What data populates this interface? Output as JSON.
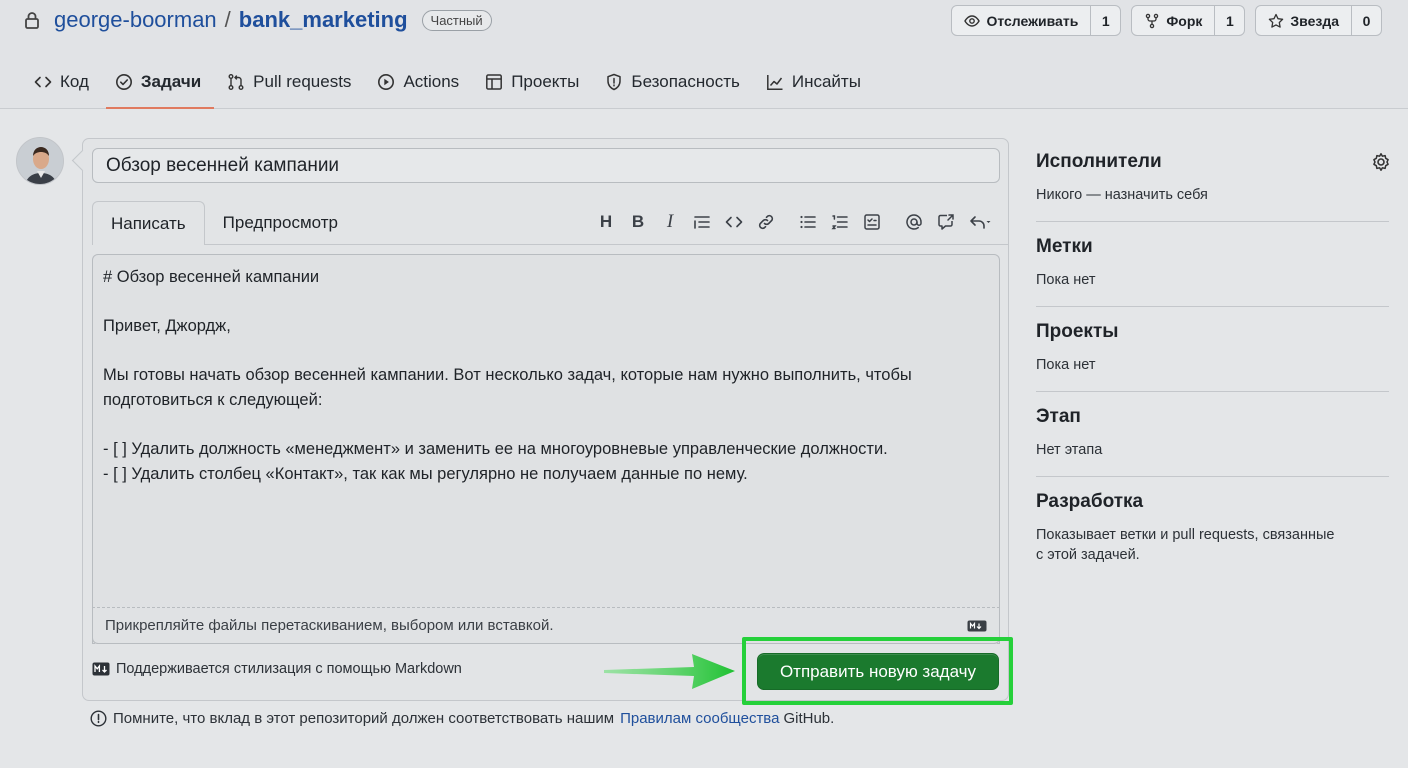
{
  "repo": {
    "owner": "george-boorman",
    "separator": "/",
    "name": "bank_marketing",
    "visibility": "Частный"
  },
  "actions": {
    "watch": {
      "label": "Отслеживать",
      "count": "1"
    },
    "fork": {
      "label": "Форк",
      "count": "1"
    },
    "star": {
      "label": "Звезда",
      "count": "0"
    }
  },
  "nav": {
    "code": "Код",
    "issues": "Задачи",
    "pulls": "Pull requests",
    "actions": "Actions",
    "projects": "Проекты",
    "security": "Безопасность",
    "insights": "Инсайты"
  },
  "form": {
    "title_value": "Обзор весенней кампании",
    "tab_write": "Написать",
    "tab_preview": "Предпросмотр",
    "toolbar_heading": "H",
    "toolbar_bold": "B",
    "toolbar_italic": "I",
    "body": "# Обзор весенней кампании\n\nПривет, Джордж,\n\nМы готовы начать обзор весенней кампании. Вот несколько задач, которые нам нужно выполнить, чтобы\nподготовиться к следующей:\n\n- [ ] Удалить должность «менеджмент» и заменить ее на многоуровневые управленческие должности.\n- [ ] Удалить столбец «Контакт», так как мы регулярно не получаем данные по нему.",
    "attach_hint": "Прикрепляйте файлы перетаскиванием, выбором или вставкой.",
    "markdown_note": "Поддерживается стилизация с помощью Markdown",
    "submit_label": "Отправить новую задачу",
    "notice_prefix": "Помните, что вклад в этот репозиторий должен соответствовать нашим",
    "notice_link": "Правилам сообщества",
    "notice_suffix": "GitHub."
  },
  "sidebar": {
    "assignees": {
      "title": "Исполнители",
      "value": "Никого — назначить себя"
    },
    "labels": {
      "title": "Метки",
      "value": "Пока нет"
    },
    "projects": {
      "title": "Проекты",
      "value": "Пока нет"
    },
    "milestone": {
      "title": "Этап",
      "value": "Нет этапа"
    },
    "development": {
      "title": "Разработка",
      "value": "Показывает ветки и pull requests, связанные с этой задачей."
    }
  },
  "colors": {
    "submit": "#1b7a2e",
    "highlight": "#25d03a",
    "link": "#1f4f9c",
    "active_tab_underline": "#e07a5f"
  }
}
